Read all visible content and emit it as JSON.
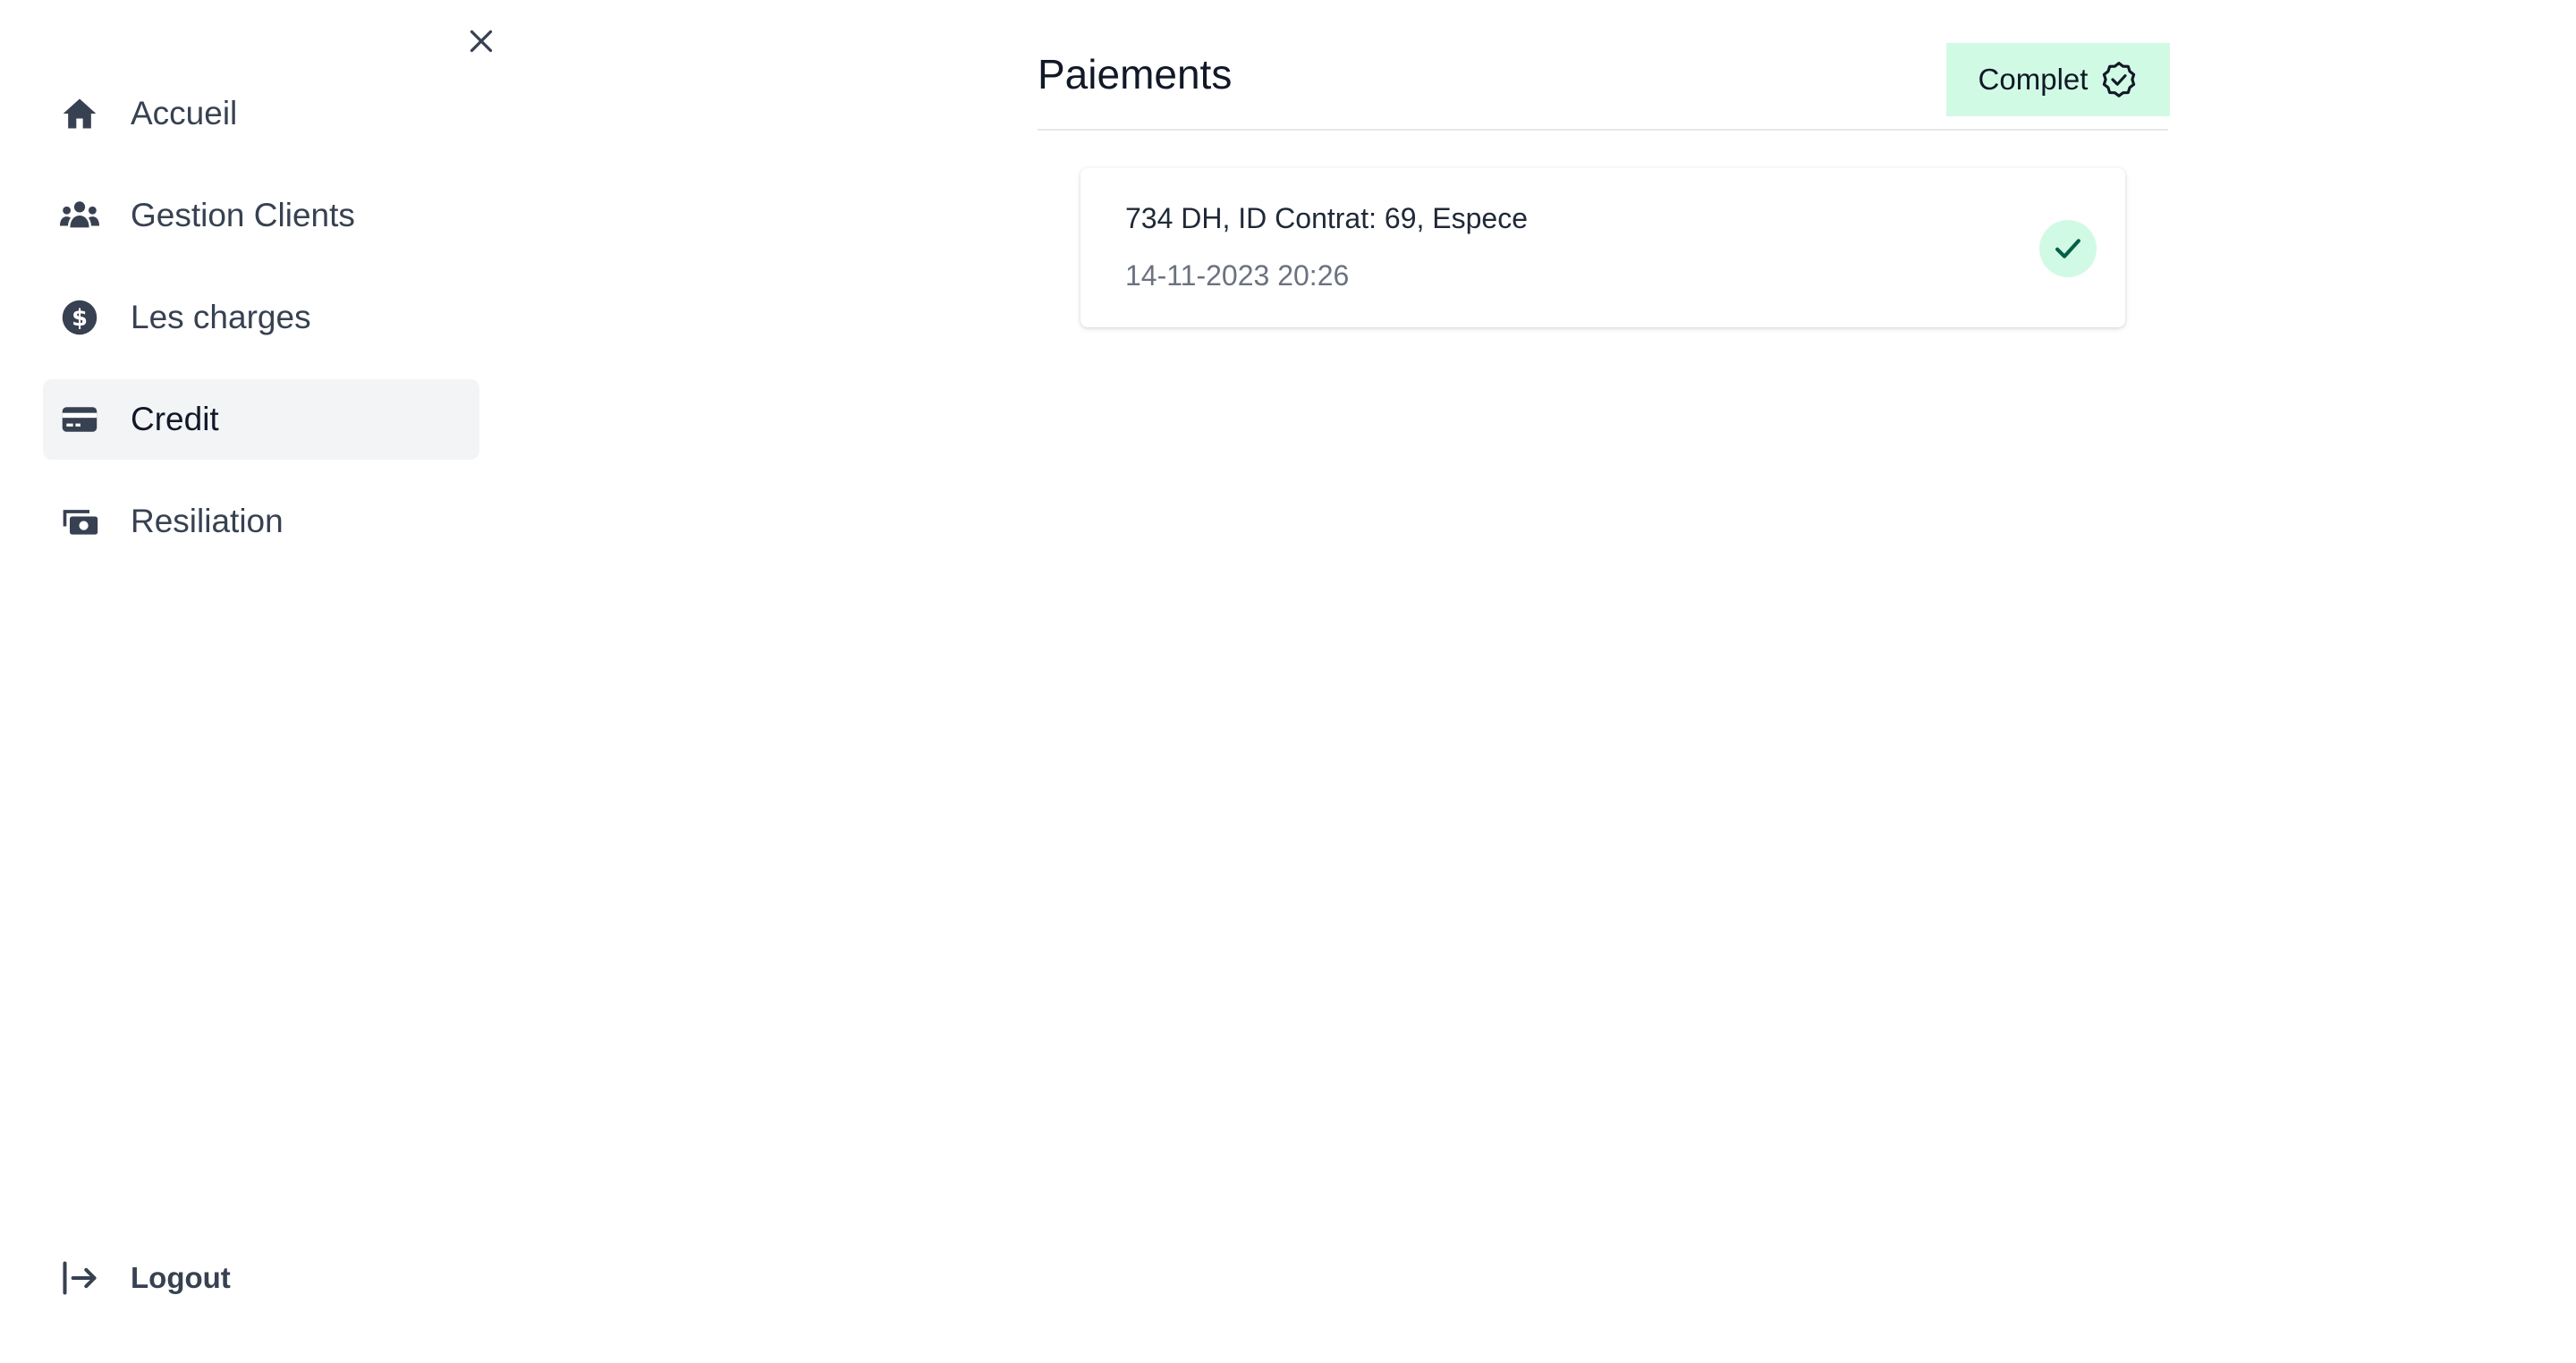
{
  "sidebar": {
    "items": [
      {
        "label": "Accueil",
        "icon": "home-icon"
      },
      {
        "label": "Gestion Clients",
        "icon": "users-icon"
      },
      {
        "label": "Les charges",
        "icon": "dollar-circle-icon"
      },
      {
        "label": "Credit",
        "icon": "credit-card-icon",
        "active": true
      },
      {
        "label": "Resiliation",
        "icon": "money-stack-icon"
      }
    ],
    "logout_label": "Logout"
  },
  "main": {
    "title": "Paiements",
    "status": {
      "label": "Complet",
      "icon": "check-badge-icon"
    },
    "payments": [
      {
        "summary": "734 DH, ID Contrat: 69, Espece",
        "datetime": "14-11-2023 20:26",
        "status_icon": "check-icon"
      }
    ]
  },
  "colors": {
    "success_bg": "#d1fae5",
    "success_fg": "#065f46",
    "active_bg": "#f3f4f6",
    "icon": "#374151"
  }
}
